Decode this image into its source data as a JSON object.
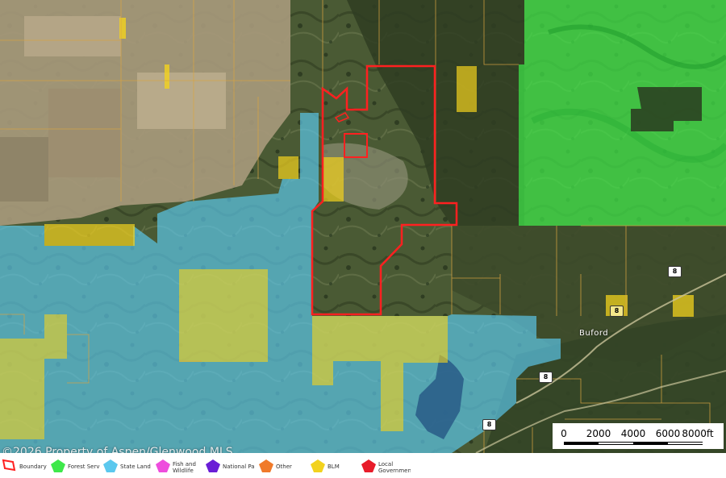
{
  "map": {
    "town": "Buford",
    "route_shields": [
      "8",
      "8",
      "8",
      "8"
    ],
    "copyright": "©2026 Property of Aspen/Glenwood MLS",
    "scale": {
      "labels": [
        "0",
        "2000",
        "4000",
        "6000",
        "8000ft"
      ]
    },
    "colors": {
      "forest_service": "#3ee84a",
      "state_land": "#5bc8ee",
      "blm": "#e8d22a",
      "boundary": "#ff2020",
      "parcel_lines": "#d9a441"
    }
  },
  "legend": [
    {
      "label": "Boundary",
      "color": "#ff2020",
      "icon": "boundary-outline-icon"
    },
    {
      "label": "Forest Servic",
      "color": "#3ee84a",
      "icon": "forest-service-swatch-icon"
    },
    {
      "label": "State Land",
      "color": "#5bc8ee",
      "icon": "state-land-swatch-icon"
    },
    {
      "label": "Fish and Wildlife",
      "color": "#ee4ddd",
      "icon": "fish-wildlife-swatch-icon"
    },
    {
      "label": "National Parl",
      "color": "#6a1ed6",
      "icon": "national-park-swatch-icon"
    },
    {
      "label": "Other",
      "color": "#f07a2a",
      "icon": "other-swatch-icon"
    },
    {
      "label": "BLM",
      "color": "#f2d21e",
      "icon": "blm-swatch-icon"
    },
    {
      "label": "Local Government",
      "color": "#e81c2a",
      "icon": "local-government-swatch-icon"
    }
  ]
}
